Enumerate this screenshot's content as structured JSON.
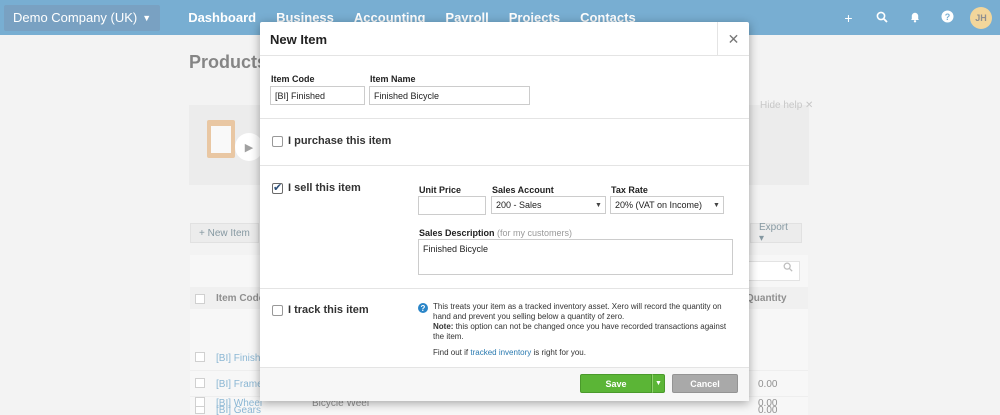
{
  "nav": {
    "org": "Demo Company (UK)",
    "items": [
      "Dashboard",
      "Business",
      "Accounting",
      "Payroll",
      "Projects",
      "Contacts"
    ],
    "active": "Business",
    "avatar": "JH"
  },
  "page": {
    "title": "Products",
    "hide_help": "Hide help",
    "new_item": "+ New Item",
    "export": "Export ▾",
    "columns": {
      "item_code": "Item Code ▲",
      "quantity": "Quantity"
    },
    "rows": [
      {
        "code": "[BI] Finished",
        "name": "",
        "qty": ""
      },
      {
        "code": "[BI] Frame",
        "name": "",
        "qty": "0.00"
      },
      {
        "code": "[BI] Gears",
        "name": "",
        "qty": "0.00"
      },
      {
        "code": "[BI] Wheel",
        "name": "Bicycle Weel",
        "qty": "0.00"
      }
    ]
  },
  "modal": {
    "title": "New Item",
    "item_code_label": "Item Code",
    "item_code_value": "[BI] Finished",
    "item_name_label": "Item Name",
    "item_name_value": "Finished Bicycle",
    "purchase_label": "I purchase this item",
    "sell_label": "I sell this item",
    "unit_price_label": "Unit Price",
    "unit_price_value": "",
    "sales_account_label": "Sales Account",
    "sales_account_value": "200 - Sales",
    "tax_rate_label": "Tax Rate",
    "tax_rate_value": "20% (VAT on Income)",
    "sales_desc_label": "Sales Description",
    "sales_desc_hint": "(for my customers)",
    "sales_desc_value": "Finished Bicycle",
    "track_label": "I track this item",
    "info_text": "This treats your item as a tracked inventory asset. Xero will record the quantity on hand and prevent you selling below a quantity of zero.",
    "info_note_bold": "Note:",
    "info_note": " this option can not be changed once you have recorded transactions against the item.",
    "find_out_pre": "Find out if ",
    "find_out_link": "tracked inventory",
    "find_out_post": " is right for you.",
    "save": "Save",
    "cancel": "Cancel"
  },
  "colors": {
    "nav_bg": "#0a6cae",
    "save_green": "#5bb536",
    "cancel_grey": "#a9a9a9"
  }
}
